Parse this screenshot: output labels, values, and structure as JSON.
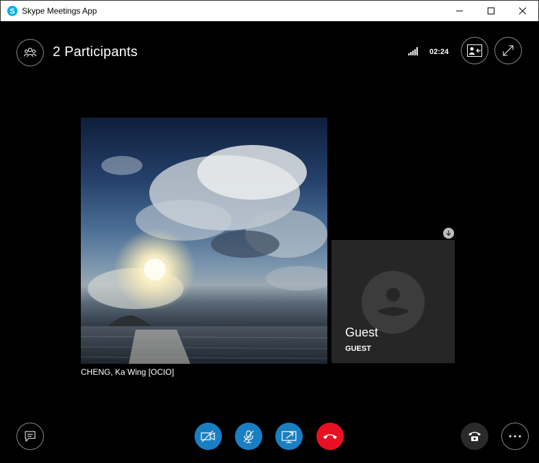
{
  "window": {
    "title": "Skype Meetings App"
  },
  "header": {
    "participants_label": "2 Participants",
    "timer": "02:24"
  },
  "videos": {
    "main": {
      "name": "CHENG, Ka Wing [OCIO]"
    },
    "guest": {
      "display_name": "Guest",
      "role": "GUEST"
    }
  },
  "colors": {
    "accent_blue": "#1a7fc2",
    "hangup_red": "#e81123"
  }
}
